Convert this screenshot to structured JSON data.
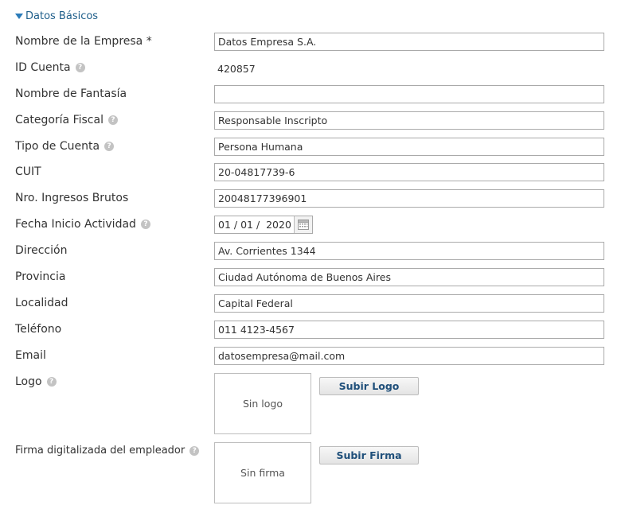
{
  "section": {
    "title": "Datos Básicos",
    "expanded": true
  },
  "help_glyph": "?",
  "fields": {
    "nombre_empresa": {
      "label": "Nombre de la Empresa *",
      "value": "Datos Empresa S.A."
    },
    "id_cuenta": {
      "label": "ID Cuenta",
      "value": "420857"
    },
    "nombre_fantasia": {
      "label": "Nombre de Fantasía",
      "value": ""
    },
    "categoria_fiscal": {
      "label": "Categoría Fiscal",
      "value": "Responsable Inscripto"
    },
    "tipo_cuenta": {
      "label": "Tipo de Cuenta",
      "value": "Persona Humana"
    },
    "cuit": {
      "label": "CUIT",
      "value": "20-04817739-6"
    },
    "ingresos_brutos": {
      "label": "Nro. Ingresos Brutos",
      "value": "20048177396901"
    },
    "fecha_inicio": {
      "label": "Fecha Inicio Actividad",
      "value": "01 / 01 /  2020"
    },
    "direccion": {
      "label": "Dirección",
      "value": "Av. Corrientes 1344"
    },
    "provincia": {
      "label": "Provincia",
      "value": "Ciudad Autónoma de Buenos Aires"
    },
    "localidad": {
      "label": "Localidad",
      "value": "Capital Federal"
    },
    "telefono": {
      "label": "Teléfono",
      "value": "011 4123-4567"
    },
    "email": {
      "label": "Email",
      "value": "datosempresa@mail.com"
    }
  },
  "logo": {
    "label": "Logo",
    "placeholder": "Sin logo",
    "button": "Subir Logo"
  },
  "firma": {
    "label": "Firma digitalizada del empleador",
    "placeholder": "Sin firma",
    "button": "Subir Firma"
  },
  "colors": {
    "accent": "#1f5f8b",
    "help_icon": "#c3c3c3",
    "border": "#aaaaaa"
  }
}
